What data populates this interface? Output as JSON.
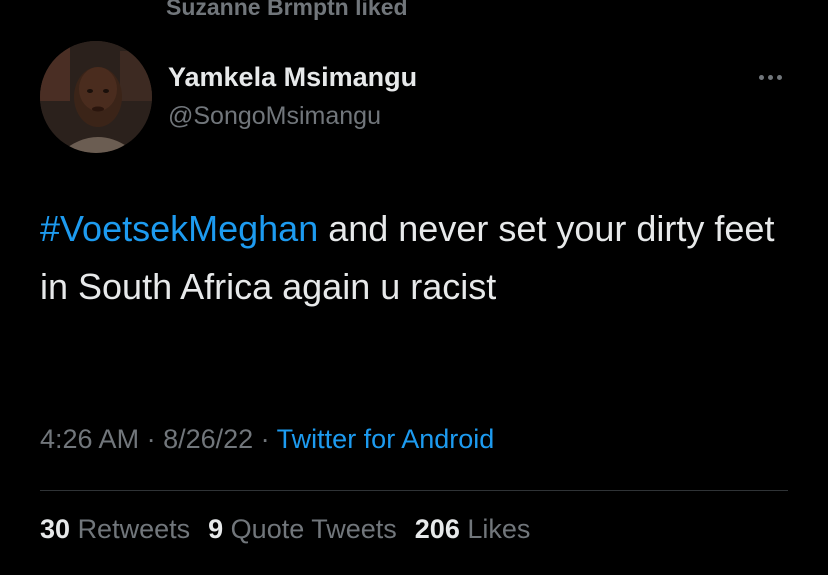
{
  "social_context": {
    "text": "Suzanne Brmptn liked",
    "icon": "heart-icon"
  },
  "author": {
    "name": "Yamkela Msimangu",
    "handle": "@SongoMsimangu"
  },
  "tweet": {
    "hashtag": "#VoetsekMeghan",
    "text": " and never set your dirty feet in South Africa again u racist"
  },
  "meta": {
    "time": "4:26 AM",
    "sep1": " · ",
    "date": "8/26/22",
    "sep2": " · ",
    "source": "Twitter for Android"
  },
  "stats": {
    "retweets_count": "30",
    "retweets_label": "Retweets",
    "quotes_count": "9",
    "quotes_label": "Quote Tweets",
    "likes_count": "206",
    "likes_label": "Likes"
  },
  "colors": {
    "background": "#000000",
    "primary_text": "#e7e9ea",
    "secondary_text": "#71767b",
    "accent": "#1d9bf0",
    "divider": "#2f3336"
  }
}
